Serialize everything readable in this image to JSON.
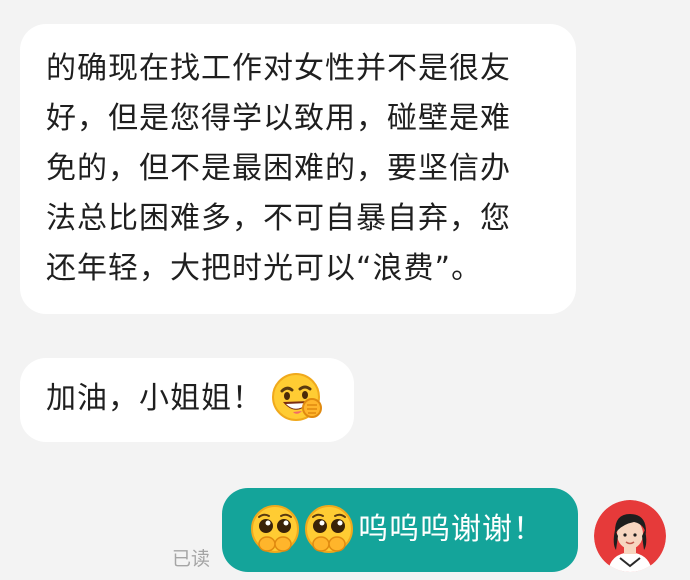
{
  "messages": {
    "incoming_1": {
      "lines": [
        "的确现在找工作对女性并不是很友",
        "好，但是您得学以致用，碰壁是难",
        "免的，但不是最困难的，要坚信办",
        "法总比困难多，不可自暴自弃，您",
        "还年轻，大把时光可以“浪费”。"
      ]
    },
    "incoming_2": {
      "text": "加油，小姐姐！",
      "emoji": "grinning-fist-emoji"
    },
    "outgoing": {
      "emojis": [
        "pleading-face-emoji",
        "pleading-face-emoji"
      ],
      "text": "呜呜呜谢谢！",
      "status": "已读"
    }
  },
  "colors": {
    "background": "#f3f3f3",
    "incoming_bubble": "#ffffff",
    "outgoing_bubble": "#14a49a",
    "read_status": "#a5a5a5"
  },
  "avatar": {
    "icon": "woman-avatar-icon"
  }
}
